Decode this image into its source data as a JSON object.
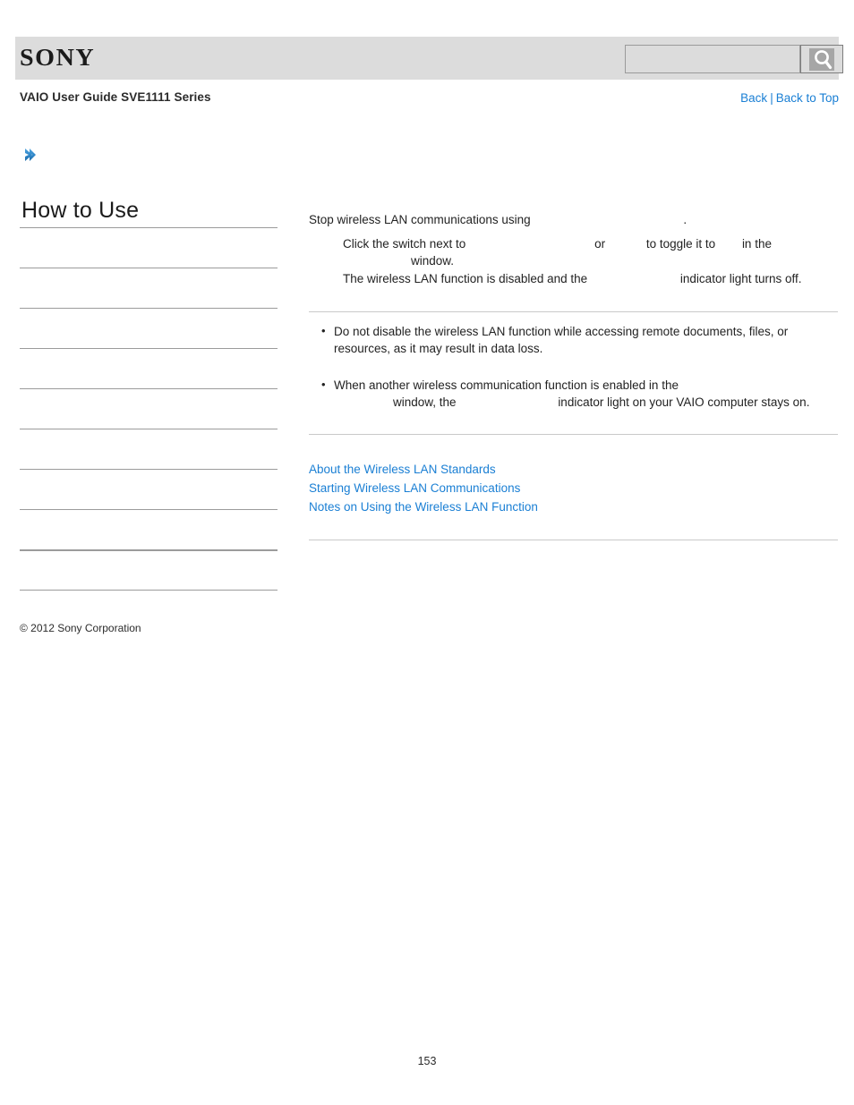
{
  "header": {
    "logo_text": "SONY",
    "logo_icon": "sony-wordmark",
    "search": {
      "value": "",
      "placeholder": "",
      "button_icon": "search-icon"
    }
  },
  "guide": {
    "title": "VAIO User Guide SVE1111 Series",
    "nav": {
      "back_label": "Back",
      "separator": "|",
      "back_to_top_label": "Back to Top"
    }
  },
  "breadcrumb": {
    "arrow_icon": "chevron-right-icon",
    "label": ""
  },
  "sidebar": {
    "title": "How to Use",
    "items": [
      {
        "label": "",
        "thick": false
      },
      {
        "label": "",
        "thick": false
      },
      {
        "label": "",
        "thick": false
      },
      {
        "label": "",
        "thick": false
      },
      {
        "label": "",
        "thick": false
      },
      {
        "label": "",
        "thick": false
      },
      {
        "label": "",
        "thick": false
      },
      {
        "label": "",
        "thick": false
      },
      {
        "label": "",
        "thick": true
      },
      {
        "label": "",
        "thick": false
      }
    ]
  },
  "content": {
    "lead": "Stop wireless LAN communications using",
    "lead_tail": ".",
    "steps": [
      {
        "part1": "Click the switch next to",
        "part2": "or",
        "part3": "to toggle it to",
        "part4": "in the",
        "part5": "window."
      },
      {
        "part1": "The wireless LAN function is disabled and the",
        "part2": "indicator light turns off."
      }
    ],
    "bullets": [
      {
        "line1": "Do not disable the wireless LAN function while accessing remote documents, files, or",
        "line2": "resources, as it may result in data loss."
      },
      {
        "line1": "When another wireless communication function is enabled in the",
        "line2_a": "window, the",
        "line2_b": "indicator light on your VAIO computer stays on."
      }
    ],
    "related_links": [
      "About the Wireless LAN Standards",
      "Starting Wireless LAN Communications",
      "Notes on Using the Wireless LAN Function"
    ]
  },
  "footer": {
    "copyright": "© 2012 Sony Corporation",
    "page_number": "153"
  },
  "colors": {
    "link": "#1a7fd4",
    "header_band": "#dcdcdc",
    "rule": "#9b9b9b"
  }
}
